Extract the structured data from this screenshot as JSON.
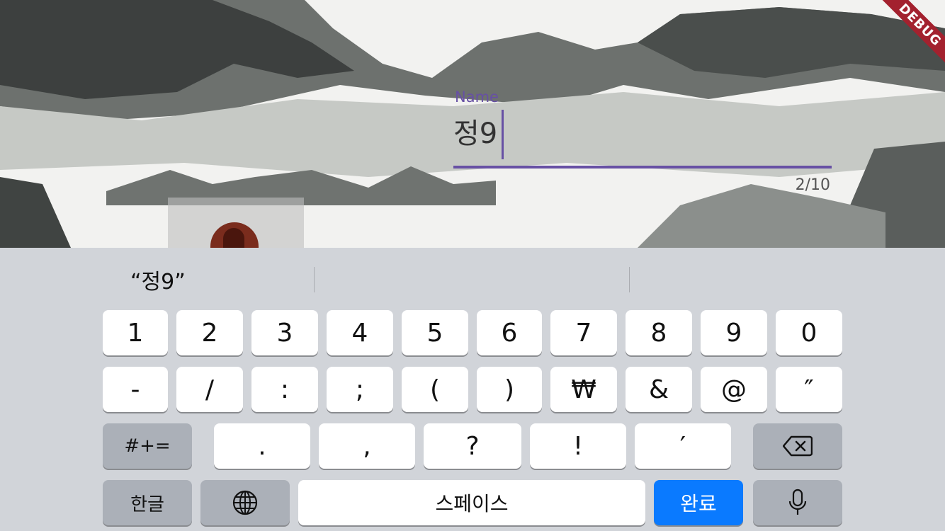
{
  "debug_banner": "DEBUG",
  "name_field": {
    "label": "Name",
    "value": "정9",
    "counter": "2/10"
  },
  "keyboard": {
    "suggestion": "“정9”",
    "row1": [
      "1",
      "2",
      "3",
      "4",
      "5",
      "6",
      "7",
      "8",
      "9",
      "0"
    ],
    "row2": [
      "-",
      "/",
      ":",
      ";",
      "(",
      ")",
      "₩",
      "&",
      "@",
      "″"
    ],
    "row3": {
      "symbols_toggle": "#+=",
      "keys": [
        ".",
        ",",
        "?",
        "!",
        "′"
      ]
    },
    "row4": {
      "hangul": "한글",
      "space": "스페이스",
      "done": "완료"
    }
  },
  "colors": {
    "accent": "#6750a4",
    "done_key": "#0a7aff",
    "debug_ribbon": "#a3212e"
  }
}
